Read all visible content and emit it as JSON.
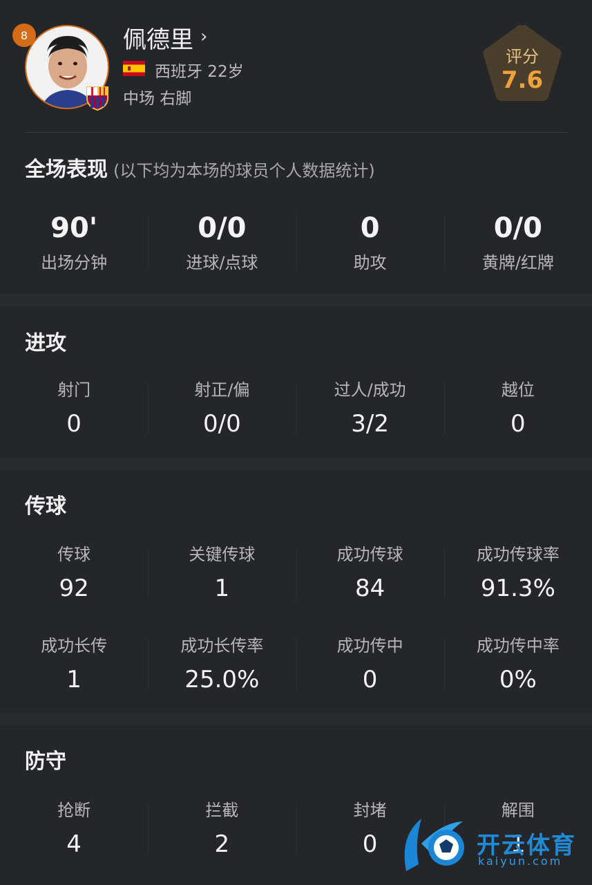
{
  "player": {
    "number": "8",
    "name": "佩德里",
    "arrow": "›",
    "nation_age": "西班牙 22岁",
    "position_foot": "中场  右脚"
  },
  "rating": {
    "label": "评分",
    "value": "7.6"
  },
  "overview": {
    "title": "全场表现",
    "note": "(以下均为本场的球员个人数据统计)",
    "items": [
      {
        "value": "90'",
        "label": "出场分钟"
      },
      {
        "value": "0/0",
        "label": "进球/点球"
      },
      {
        "value": "0",
        "label": "助攻"
      },
      {
        "value": "0/0",
        "label": "黄牌/红牌"
      }
    ]
  },
  "attack": {
    "title": "进攻",
    "items": [
      {
        "label": "射门",
        "value": "0"
      },
      {
        "label": "射正/偏",
        "value": "0/0"
      },
      {
        "label": "过人/成功",
        "value": "3/2"
      },
      {
        "label": "越位",
        "value": "0"
      }
    ]
  },
  "passing": {
    "title": "传球",
    "row1": [
      {
        "label": "传球",
        "value": "92"
      },
      {
        "label": "关键传球",
        "value": "1"
      },
      {
        "label": "成功传球",
        "value": "84"
      },
      {
        "label": "成功传球率",
        "value": "91.3%"
      }
    ],
    "row2": [
      {
        "label": "成功长传",
        "value": "1"
      },
      {
        "label": "成功长传率",
        "value": "25.0%"
      },
      {
        "label": "成功传中",
        "value": "0"
      },
      {
        "label": "成功传中率",
        "value": "0%"
      }
    ]
  },
  "defense": {
    "title": "防守",
    "items": [
      {
        "label": "抢断",
        "value": "4"
      },
      {
        "label": "拦截",
        "value": "2"
      },
      {
        "label": "封堵",
        "value": "0"
      },
      {
        "label": "解围",
        "value": "1"
      }
    ]
  },
  "watermark": {
    "cn": "开云体育",
    "en": "kaiyun.com"
  },
  "colors": {
    "accent": "#d36b17",
    "rating": "#f1a13a",
    "card": "#25262a",
    "page": "#2a2b2e"
  },
  "icons": [
    "player-avatar",
    "club-crest-icon",
    "spain-flag-icon",
    "chevron-right-icon",
    "rating-pentagon-icon",
    "watermark-logo"
  ]
}
